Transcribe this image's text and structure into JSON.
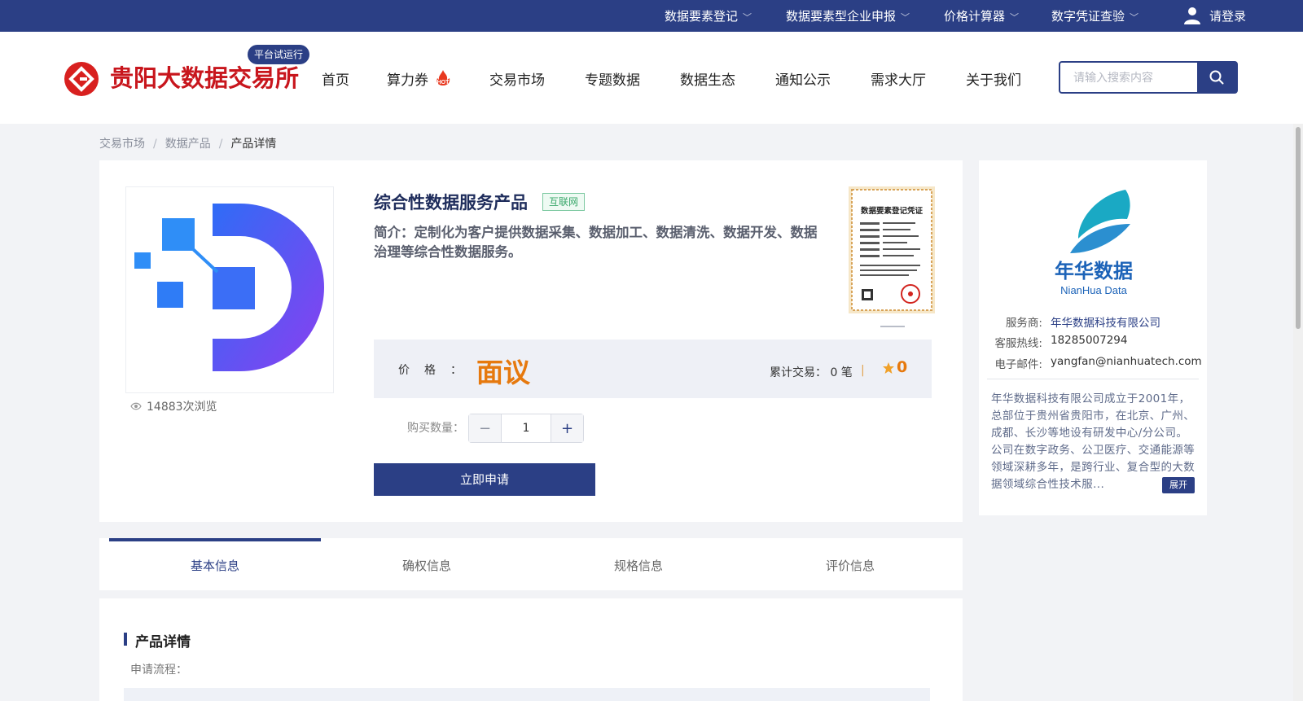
{
  "topbar": {
    "links": [
      "数据要素登记",
      "数据要素型企业申报",
      "价格计算器",
      "数字凭证查验"
    ],
    "login": "请登录"
  },
  "header": {
    "site_name": "贵阳大数据交易所",
    "badge": "平台试运行",
    "nav": [
      "首页",
      "算力券",
      "交易市场",
      "专题数据",
      "数据生态",
      "通知公示",
      "需求大厅",
      "关于我们"
    ],
    "hot_label": "HOT",
    "search_placeholder": "请输入搜索内容"
  },
  "breadcrumb": [
    "交易市场",
    "数据产品",
    "产品详情"
  ],
  "product": {
    "title": "综合性数据服务产品",
    "tag": "互联网",
    "intro": "简介：定制化为客户提供数据采集、数据加工、数据清洗、数据开发、数据治理等综合性数据服务。",
    "views": "14883次浏览",
    "price_label": "价格：",
    "price_value": "面议",
    "trade_label": "累计交易：",
    "trade_value": "0 笔",
    "divider": "|",
    "rating": "0",
    "qty_label": "购买数量：",
    "quantity": "1",
    "apply_label": "立即申请",
    "cert_title": "数据要素登记凭证"
  },
  "provider": {
    "logo_cn": "年华数据",
    "logo_en": "NianHua Data",
    "rows": [
      {
        "key": "服务商:",
        "value": "年华数据科技有限公司"
      },
      {
        "key": "客服热线:",
        "value": "18285007294"
      },
      {
        "key": "电子邮件:",
        "value": "yangfan@nianhuatech.com"
      }
    ],
    "description": "年华数据科技有限公司成立于2001年，总部位于贵州省贵阳市，在北京、广州、成都、长沙等地设有研发中心/分公司。公司在数字政务、公卫医疗、交通能源等领域深耕多年，是跨行业、复合型的大数据领域综合性技术服...",
    "expand_label": "展开"
  },
  "tabs": [
    "基本信息",
    "确权信息",
    "规格信息",
    "评价信息"
  ],
  "details": {
    "section_title": "产品详情",
    "sub_label": "申请流程："
  },
  "colors": {
    "primary": "#2b3f85",
    "brand_red": "#c8161d",
    "price_orange": "#e6790e"
  }
}
